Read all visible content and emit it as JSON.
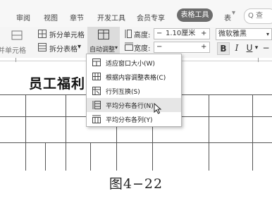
{
  "menubar": {
    "tabs": [
      "审阅",
      "视图",
      "章节",
      "开发工具",
      "会员专享"
    ],
    "active_tab": "表格工具",
    "overflow_tab": "表",
    "search_label": "Q 查"
  },
  "ribbon": {
    "merge_cells": "并单元格",
    "split_cells": "拆分单元格",
    "split_table": "拆分表格",
    "split_table_arrow": "▾",
    "auto_adjust": "自动调整",
    "auto_adjust_arrow": "▾",
    "height_label": "高度:",
    "height_value": "1.10厘米",
    "width_label": "宽度:",
    "width_value": "",
    "minus": "−",
    "plus": "+",
    "font_name": "微软雅黑",
    "bold": "B",
    "italic": "I",
    "underline": "U"
  },
  "document": {
    "title": "员工福利"
  },
  "dropdown": {
    "items": [
      "适应窗口大小(W)",
      "根据内容调整表格(C)",
      "行列互换(S)",
      "平均分布各行(N)",
      "平均分布各列(Y)"
    ],
    "hovered_item": "平均分布各行(N)"
  },
  "caption": "图4−22"
}
